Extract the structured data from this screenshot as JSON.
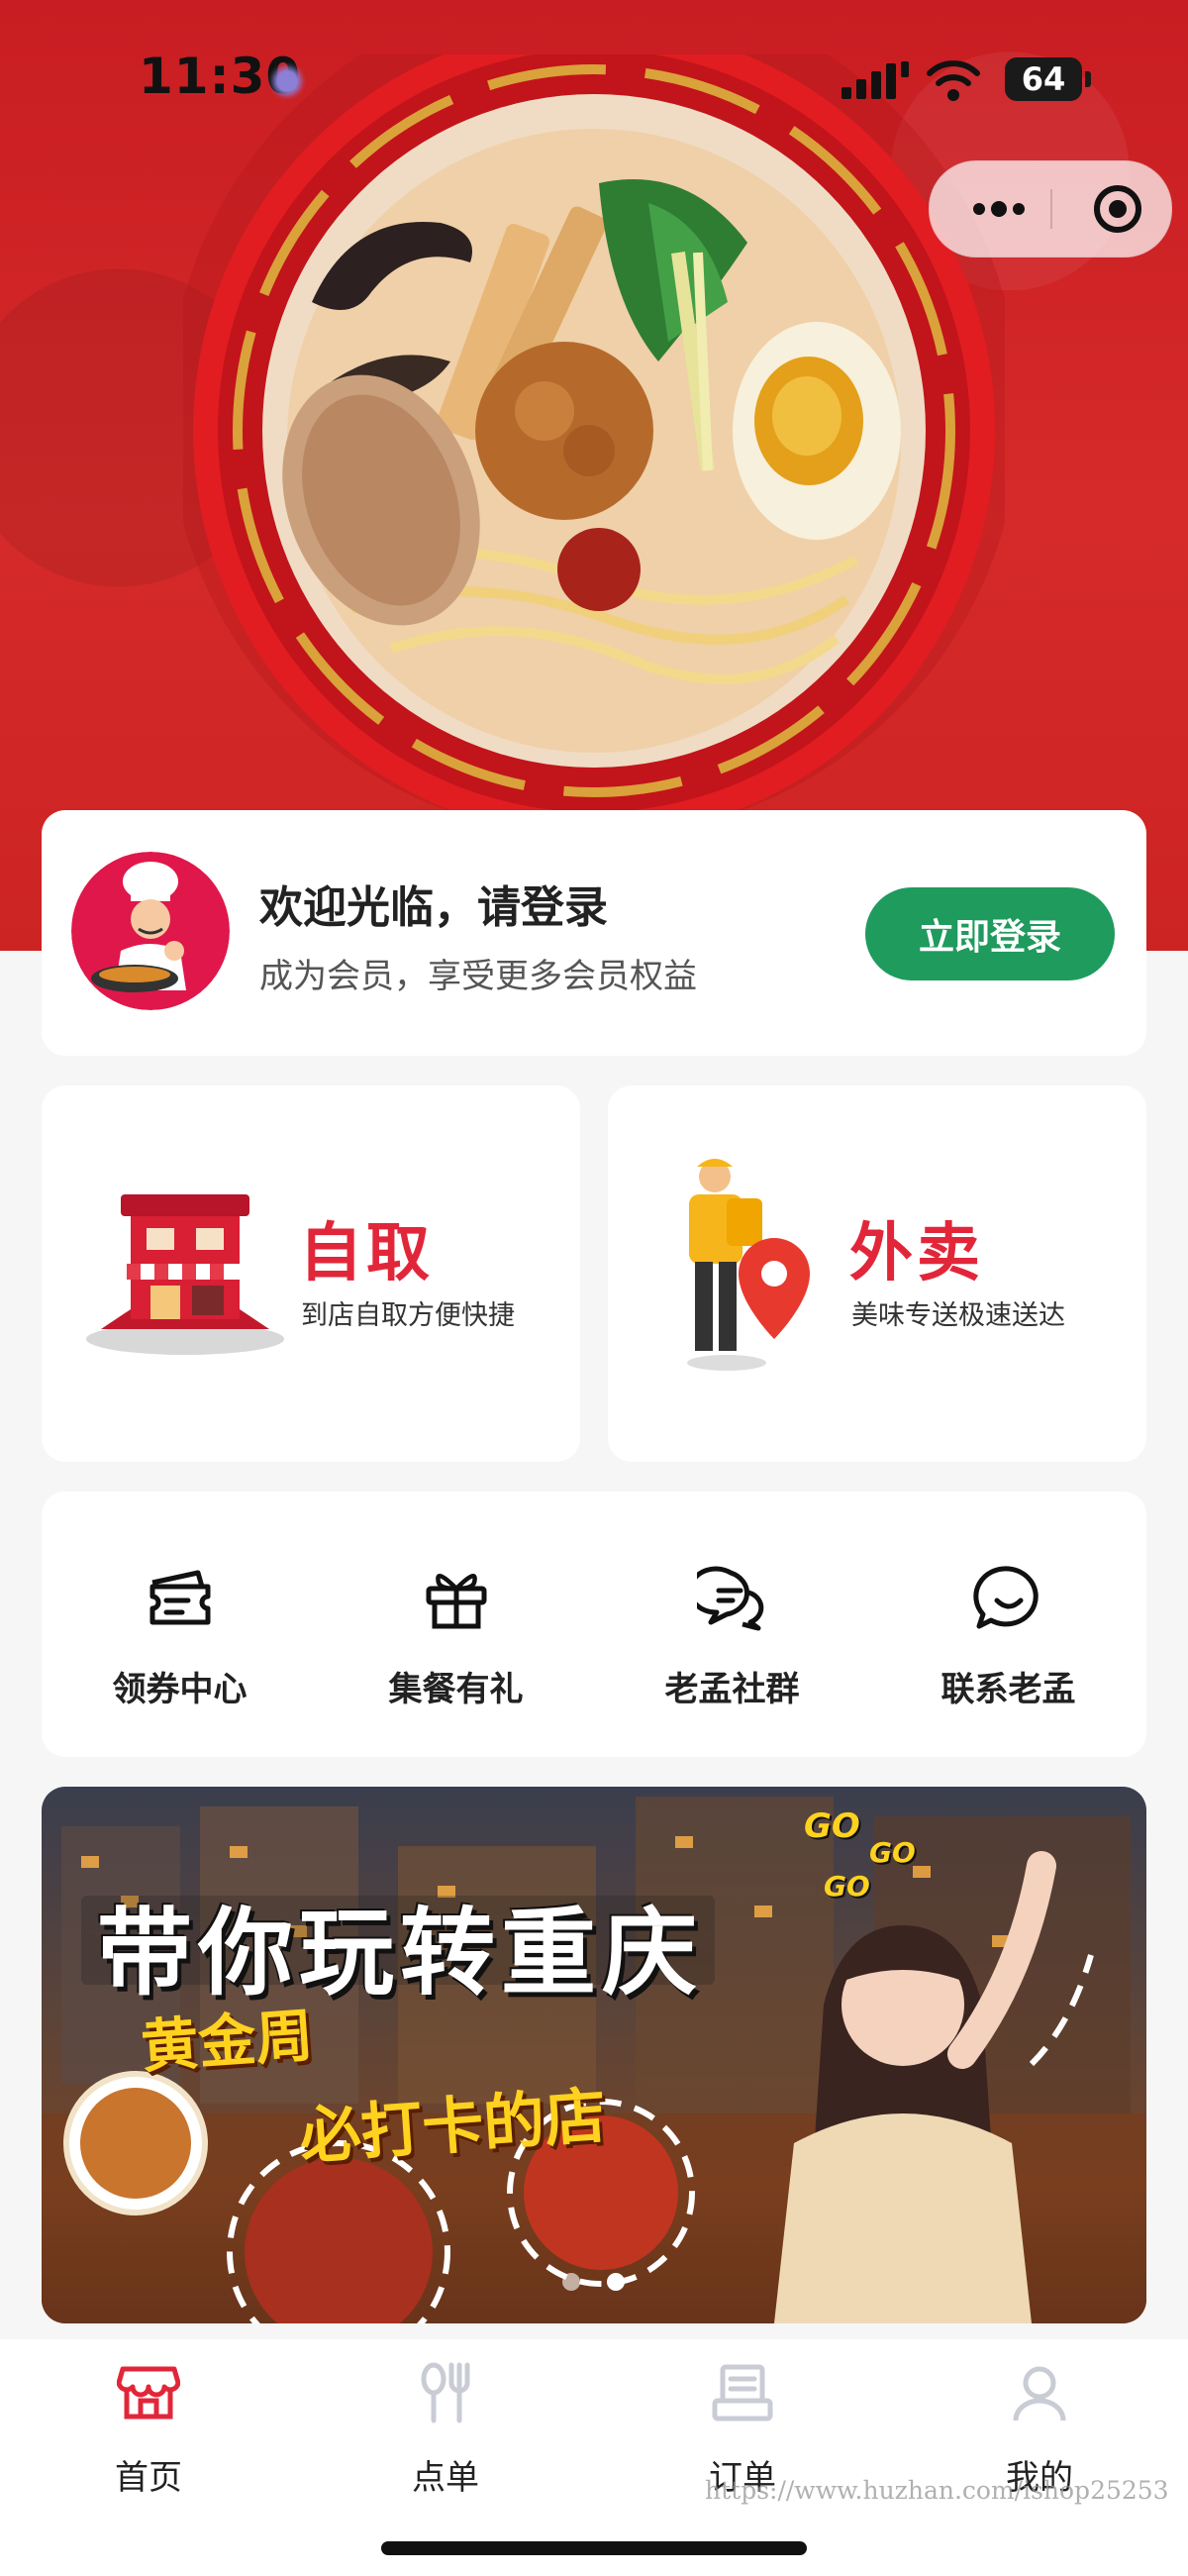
{
  "status_bar": {
    "time": "11:30",
    "battery": "64"
  },
  "colors": {
    "brand_red": "#d62a2a",
    "accent_red": "#e2263a",
    "login_green": "#1e9b5d",
    "tab_inactive": "#c9ccd4"
  },
  "hero": {
    "image": "ramen-bowl"
  },
  "login_card": {
    "title": "欢迎光临，请登录",
    "subtitle": "成为会员，享受更多会员权益",
    "button": "立即登录"
  },
  "services": [
    {
      "title": "自取",
      "subtitle": "到店自取方便快捷",
      "icon": "store-icon"
    },
    {
      "title": "外卖",
      "subtitle": "美味专送极速送达",
      "icon": "delivery-icon"
    }
  ],
  "quick_menu": [
    {
      "label": "领券中心",
      "icon": "coupon-icon"
    },
    {
      "label": "集餐有礼",
      "icon": "gift-icon"
    },
    {
      "label": "老孟社群",
      "icon": "chat-icon"
    },
    {
      "label": "联系老孟",
      "icon": "smile-chat-icon"
    }
  ],
  "banner": {
    "headline": "带你玩转重庆",
    "line2": "黄金周",
    "line3": "必打卡的店",
    "sticker": [
      "GO",
      "GO",
      "GO"
    ],
    "carousel_index": 1,
    "carousel_total": 2
  },
  "tab_bar": [
    {
      "label": "首页",
      "icon": "store-front-icon",
      "active": true
    },
    {
      "label": "点单",
      "icon": "utensils-icon",
      "active": false
    },
    {
      "label": "订单",
      "icon": "receipt-icon",
      "active": false
    },
    {
      "label": "我的",
      "icon": "user-icon",
      "active": false
    }
  ],
  "watermark": "https://www.huzhan.com/ishop25253"
}
